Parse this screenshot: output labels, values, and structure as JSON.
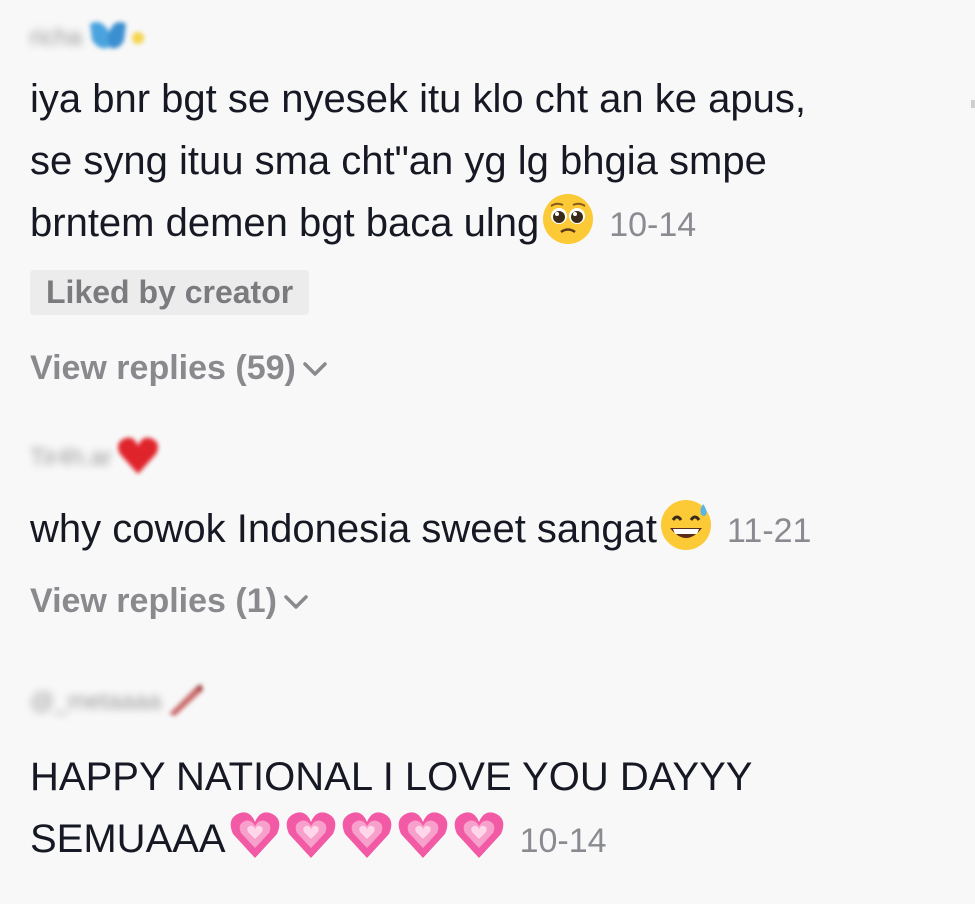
{
  "comments": [
    {
      "username": "richa",
      "text": "iya bnr bgt se nyesek itu klo cht an ke apus,\nse syng ituu sma cht\"an yg lg bhgia smpe\nbrntem demen bgt baca ulng",
      "emoji": "pleading-face-emoji",
      "date": "10-14",
      "badge": "Liked by creator",
      "replies_label": "View replies (59)"
    },
    {
      "username": "Tir4h.ar",
      "text": "why cowok Indonesia sweet sangat",
      "emoji": "grinning-sweat-emoji",
      "date": "11-21",
      "replies_label": "View replies (1)"
    },
    {
      "username": "@_metaaaa",
      "text": "HAPPY NATIONAL I LOVE YOU DAYYY\nSEMUAAA",
      "emoji": "growing-heart-emoji",
      "date": "10-14"
    }
  ],
  "colors": {
    "background": "#f8f8f8",
    "text": "#161823",
    "muted": "#8a8b91",
    "badge_bg": "#ececec"
  }
}
